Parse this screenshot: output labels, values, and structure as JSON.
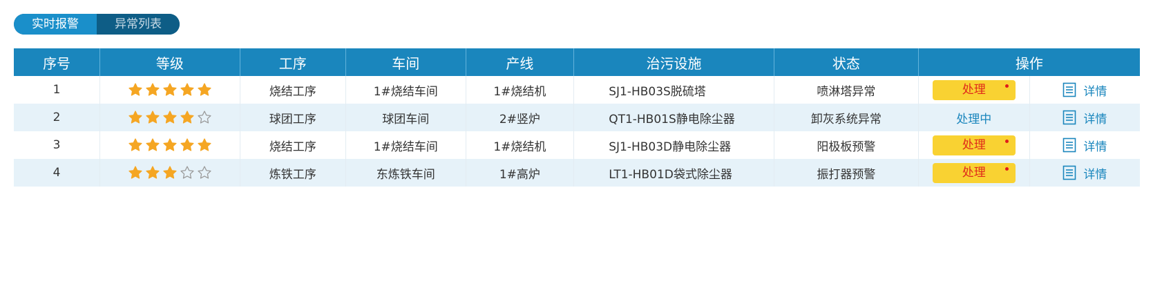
{
  "tabs": [
    {
      "label": "实时报警",
      "active": true
    },
    {
      "label": "异常列表",
      "active": false
    }
  ],
  "table": {
    "headers": [
      "序号",
      "等级",
      "工序",
      "车间",
      "产线",
      "治污设施",
      "状态",
      "操作"
    ],
    "rows": [
      {
        "index": "1",
        "level": 5,
        "process": "烧结工序",
        "workshop": "1#烧结车间",
        "line": "1#烧结机",
        "facility": "SJ1-HB03S脱硫塔",
        "status": "喷淋塔异常",
        "action": "处理",
        "action_state": "pending",
        "detail": "详情"
      },
      {
        "index": "2",
        "level": 4,
        "process": "球团工序",
        "workshop": "球团车间",
        "line": "2#竖炉",
        "facility": "QT1-HB01S静电除尘器",
        "status": "卸灰系统异常",
        "action": "处理中",
        "action_state": "processing",
        "detail": "详情"
      },
      {
        "index": "3",
        "level": 5,
        "process": "烧结工序",
        "workshop": "1#烧结车间",
        "line": "1#烧结机",
        "facility": "SJ1-HB03D静电除尘器",
        "status": "阳极板预警",
        "action": "处理",
        "action_state": "pending",
        "detail": "详情"
      },
      {
        "index": "4",
        "level": 3,
        "process": "炼铁工序",
        "workshop": "东炼铁车间",
        "line": "1#高炉",
        "facility": "LT1-HB01D袋式除尘器",
        "status": "振打器预警",
        "action": "处理",
        "action_state": "pending",
        "detail": "详情"
      }
    ],
    "max_level": 5
  },
  "colors": {
    "header_bg": "#1a86bd",
    "tab_active": "#1a8fca",
    "tab_inactive": "#0e5d86",
    "row_alt": "#e6f2f9",
    "star_filled": "#f5a623",
    "star_empty": "#9a9a9a",
    "handle_bg": "#f9d232",
    "handle_text": "#e02a1a",
    "link": "#1a86bd"
  },
  "icons": {
    "star_filled": "star-filled-icon",
    "star_empty": "star-empty-icon",
    "detail": "document-list-icon",
    "alert_dot": "red-dot-icon"
  }
}
